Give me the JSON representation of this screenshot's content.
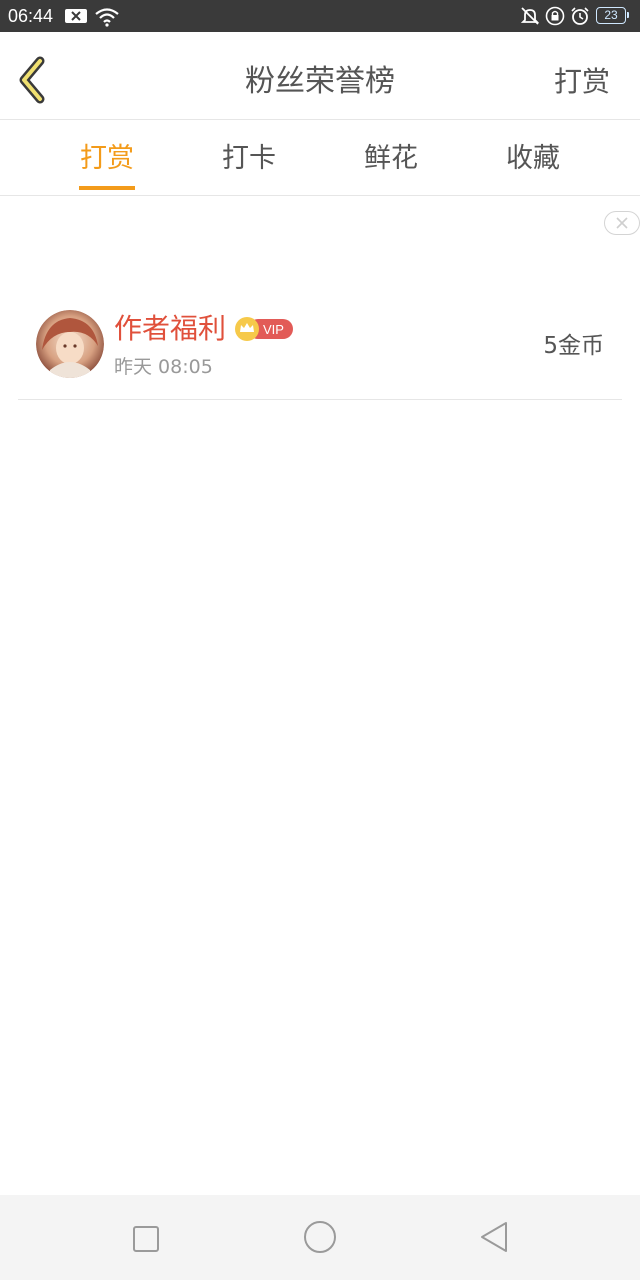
{
  "status_bar": {
    "time": "06:44",
    "battery": "23",
    "icons": [
      "notification-x-icon",
      "wifi-icon",
      "mute-icon",
      "lock-icon",
      "alarm-icon",
      "battery-icon"
    ]
  },
  "header": {
    "title": "粉丝荣誉榜",
    "action_label": "打赏",
    "back_icon": "chevron-left-icon"
  },
  "tabs": [
    {
      "label": "打赏",
      "active": true
    },
    {
      "label": "打卡",
      "active": false
    },
    {
      "label": "鲜花",
      "active": false
    },
    {
      "label": "收藏",
      "active": false
    }
  ],
  "list": [
    {
      "name": "作者福利",
      "badge": "VIP",
      "time": "昨天 08:05",
      "amount": "5金币"
    }
  ],
  "colors": {
    "accent": "#f39b1a",
    "username": "#e0503b",
    "vip_badge": "#e25b57",
    "text": "#555555",
    "muted": "#999999"
  },
  "navbar": {
    "icons": [
      "square-recents-icon",
      "circle-home-icon",
      "triangle-back-icon"
    ]
  }
}
